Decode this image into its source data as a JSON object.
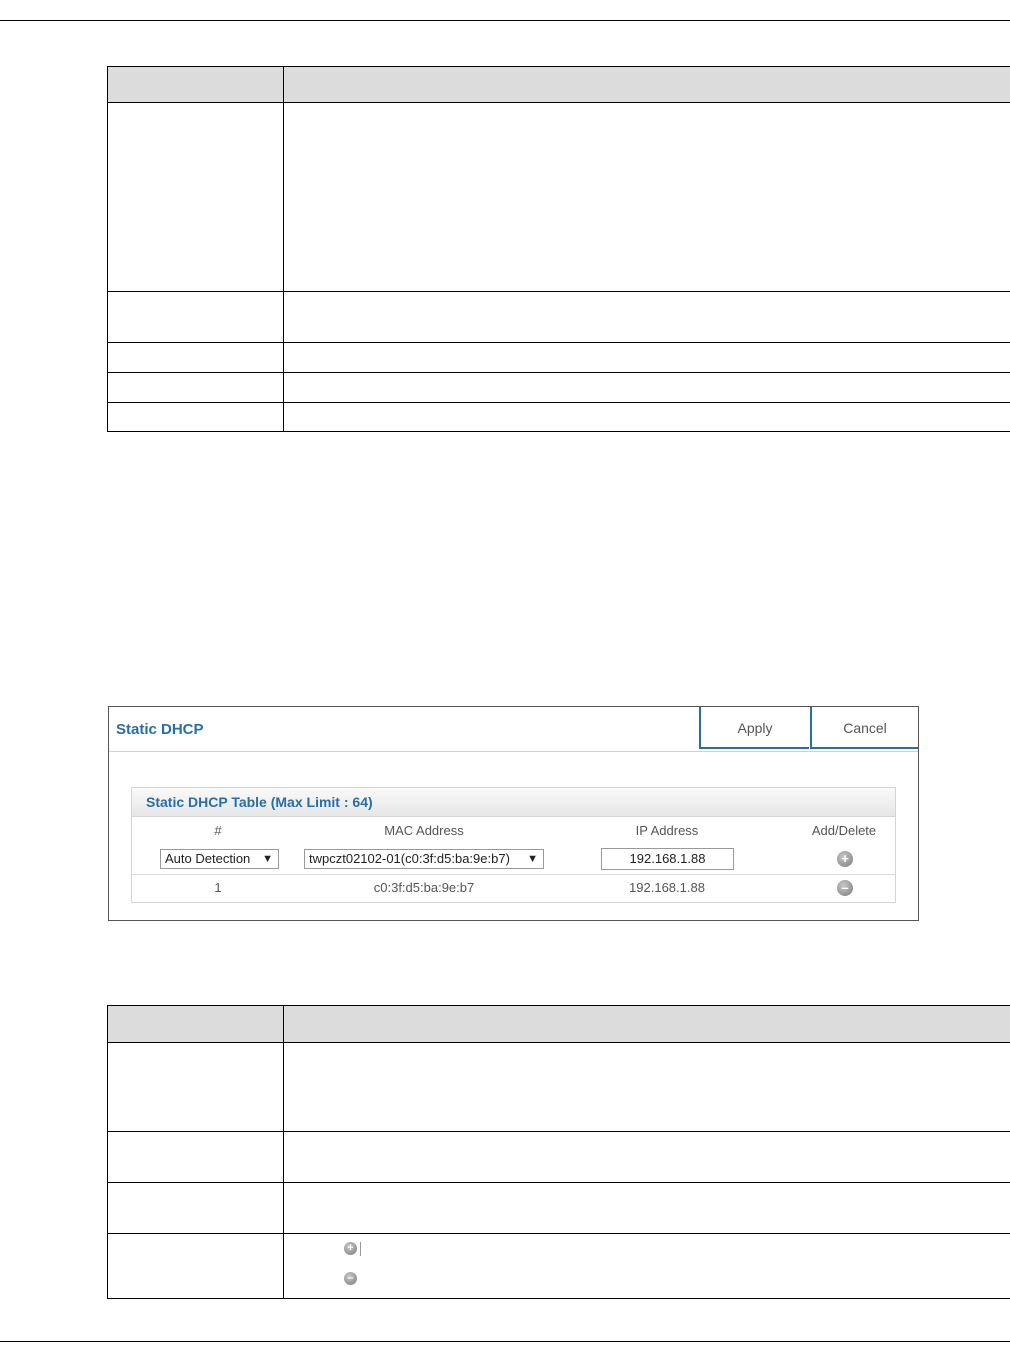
{
  "ui": {
    "panel_title": "Static DHCP",
    "apply_label": "Apply",
    "cancel_label": "Cancel",
    "table_title": "Static DHCP Table (Max Limit : 64)",
    "columns": [
      "#",
      "MAC Address",
      "IP Address",
      "Add/Delete"
    ],
    "entry_row": {
      "number_select": "Auto Detection",
      "mac_select": "twpczt02102-01(c0:3f:d5:ba:9e:b7)",
      "ip_value": "192.168.1.88"
    },
    "data_rows": [
      {
        "number": "1",
        "mac": "c0:3f:d5:ba:9e:b7",
        "ip": "192.168.1.88"
      }
    ]
  },
  "icons": {
    "add": "plus-circle-icon",
    "delete": "minus-circle-icon",
    "dropdown": "chevron-down-icon"
  },
  "glyphs": {
    "plus": "+",
    "minus": "–",
    "arrow": "▼"
  },
  "colors": {
    "accent": "#2a6ea6",
    "table_header": "#dcdcdc"
  }
}
